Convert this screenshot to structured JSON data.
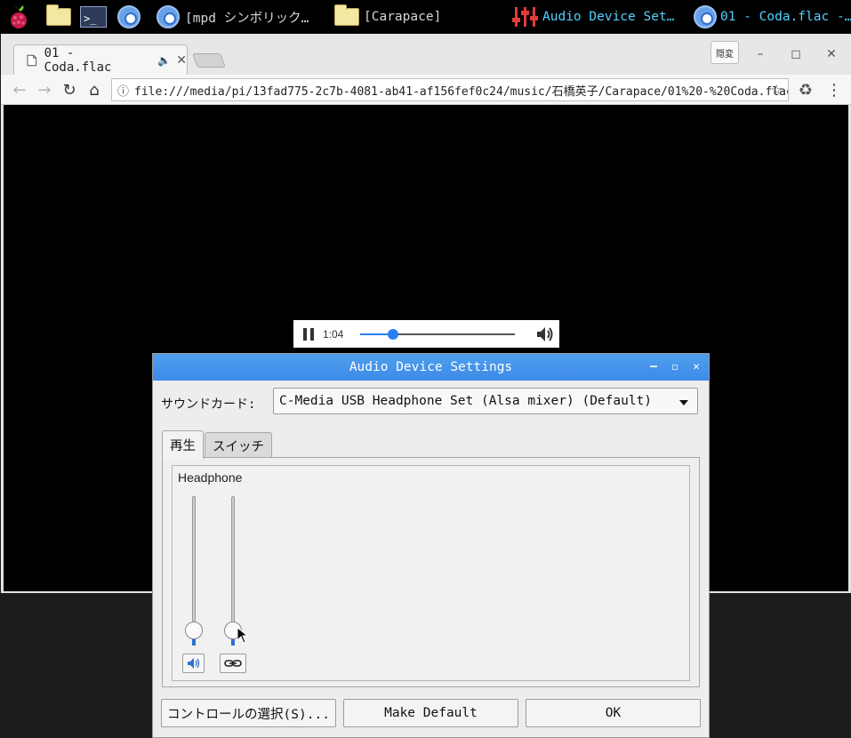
{
  "taskbar": {
    "items": [
      {
        "label": "[mpd シンボリック…",
        "icon": "chromium-icon"
      },
      {
        "label": "[Carapace]",
        "icon": "folder-icon"
      },
      {
        "label": "Audio Device Set…",
        "icon": "mixer-icon"
      },
      {
        "label": "01 - Coda.flac -…",
        "icon": "chromium-icon"
      }
    ]
  },
  "browser": {
    "tab_title": "01 - Coda.flac",
    "url": "file:///media/pi/13fad775-2c7b-4081-ab41-af156fef0c24/music/石橋英子/Carapace/01%20-%20Coda.flac",
    "ime_label": "隠変"
  },
  "media": {
    "time": "1:04",
    "progress": 0.21
  },
  "dialog": {
    "title": "Audio Device Settings",
    "card_label": "サウンドカード:",
    "card_value": "C-Media USB Headphone Set (Alsa mixer) (Default)",
    "tabs": [
      "再生",
      "スイッチ"
    ],
    "group_label": "Headphone",
    "sliders": [
      {
        "level": 0.0,
        "button_icon": "speaker-icon"
      },
      {
        "level": 0.0,
        "button_icon": "link-icon"
      }
    ],
    "buttons": {
      "select_controls": "コントロールの選択(S)...",
      "make_default": "Make Default",
      "ok": "OK"
    }
  }
}
